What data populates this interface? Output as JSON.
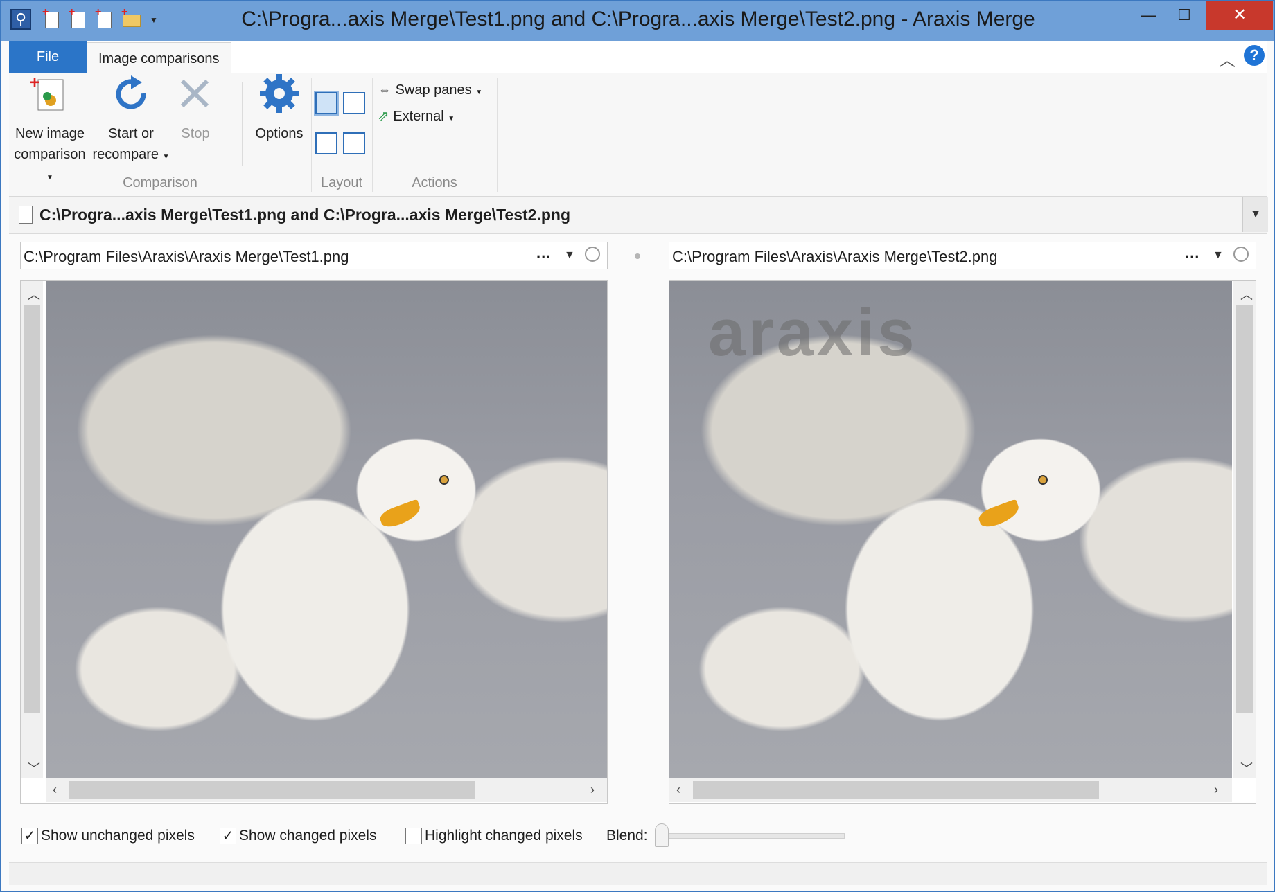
{
  "window": {
    "title": "C:\\Progra...axis Merge\\Test1.png and C:\\Progra...axis Merge\\Test2.png - Araxis Merge",
    "controls": {
      "minimize": "—",
      "maximize": "☐",
      "close": "✕"
    }
  },
  "tabs": {
    "file": "File",
    "active": "Image comparisons"
  },
  "ribbon": {
    "comparison": {
      "new_line1": "New image",
      "new_line2": "comparison",
      "start_line1": "Start or",
      "start_line2": "recompare",
      "stop": "Stop",
      "options": "Options",
      "group_label": "Comparison"
    },
    "layout": {
      "group_label": "Layout"
    },
    "actions": {
      "swap": "Swap panes",
      "external": "External",
      "group_label": "Actions"
    }
  },
  "document": {
    "title": "C:\\Progra...axis Merge\\Test1.png and C:\\Progra...axis Merge\\Test2.png"
  },
  "left_pane": {
    "path": "C:\\Program Files\\Araxis\\Araxis Merge\\Test1.png"
  },
  "right_pane": {
    "path": "C:\\Program Files\\Araxis\\Araxis Merge\\Test2.png",
    "watermark": "araxis"
  },
  "options": {
    "show_unchanged": {
      "label": "Show unchanged pixels",
      "checked": true
    },
    "show_changed": {
      "label": "Show changed pixels",
      "checked": true
    },
    "highlight_changed": {
      "label": "Highlight changed pixels",
      "checked": false
    },
    "blend_label": "Blend:",
    "blend_value": 0
  },
  "colors": {
    "accent": "#2b75c8",
    "close": "#c8382c",
    "titlebar": "#6fa0d8"
  }
}
